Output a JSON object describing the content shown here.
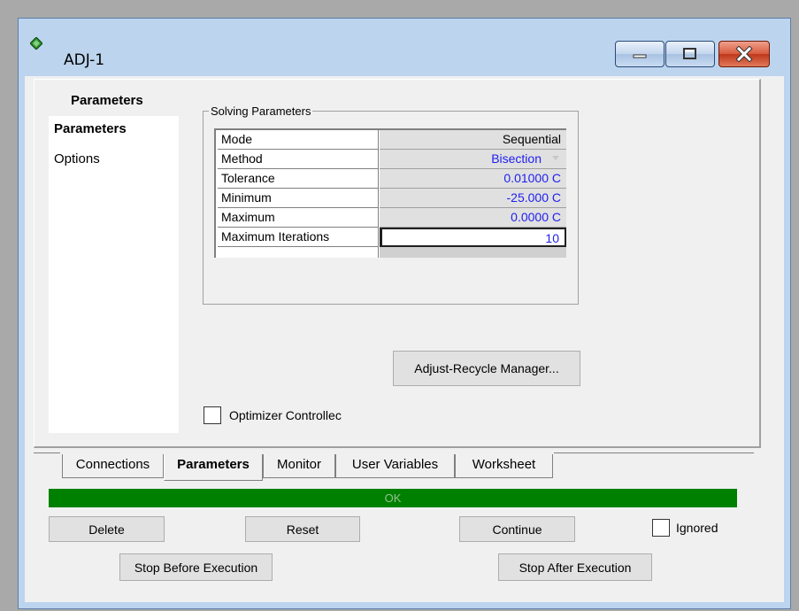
{
  "window": {
    "title": "ADJ-1",
    "controls": [
      "minimize",
      "maximize",
      "close"
    ]
  },
  "nav": {
    "title": "Parameters",
    "items": [
      {
        "label": "Parameters",
        "selected": true
      },
      {
        "label": "Options",
        "selected": false
      }
    ]
  },
  "solving": {
    "group_label": "Solving Parameters",
    "rows": [
      {
        "label": "Mode",
        "value": "Sequential"
      },
      {
        "label": "Method",
        "value": "Bisection"
      },
      {
        "label": "Tolerance",
        "value": "0.01000 C"
      },
      {
        "label": "Minimum",
        "value": "-25.000 C"
      },
      {
        "label": "Maximum",
        "value": "0.0000 C"
      },
      {
        "label": "Maximum Iterations",
        "value": "10"
      }
    ]
  },
  "buttons": {
    "adjust_recycle": "Adjust-Recycle Manager...",
    "delete": "Delete",
    "reset": "Reset",
    "continue": "Continue",
    "stop_before": "Stop Before Execution",
    "stop_after": "Stop After Execution"
  },
  "optimizer": {
    "label": "Optimizer Controllec",
    "checked": false
  },
  "ignored": {
    "label": "Ignored",
    "checked": false
  },
  "tabs": [
    {
      "label": "Connections",
      "active": false
    },
    {
      "label": "Parameters",
      "active": true
    },
    {
      "label": "Monitor",
      "active": false
    },
    {
      "label": "User Variables",
      "active": false
    },
    {
      "label": "Worksheet",
      "active": false
    }
  ],
  "status": {
    "text": "OK",
    "color": "#008000"
  }
}
